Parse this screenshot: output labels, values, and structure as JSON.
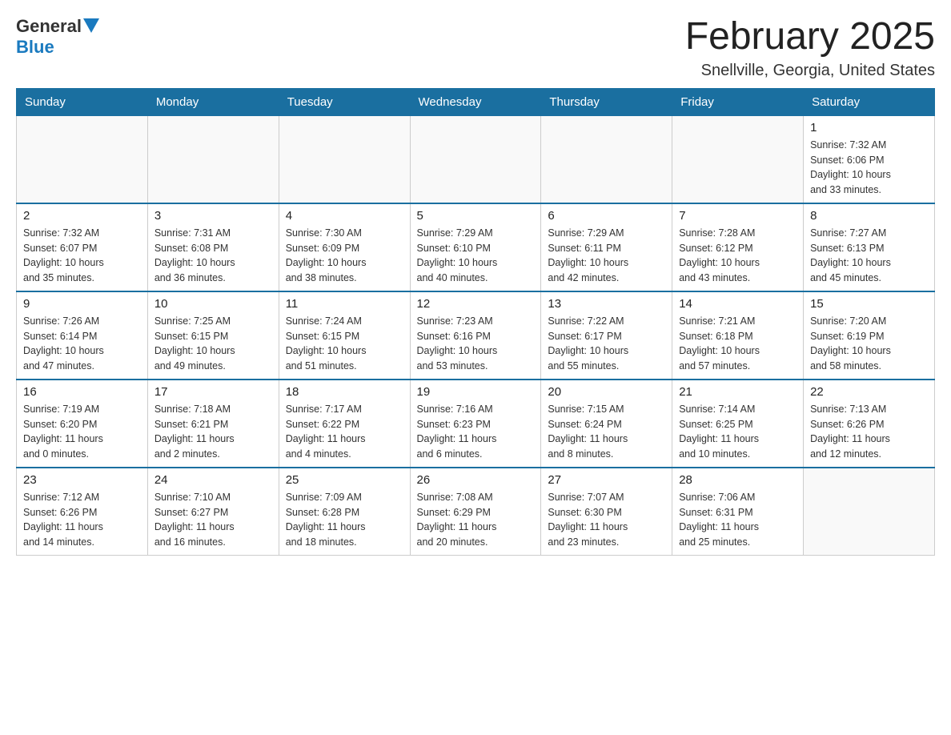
{
  "header": {
    "logo": {
      "general": "General",
      "blue": "Blue"
    },
    "title": "February 2025",
    "location": "Snellville, Georgia, United States"
  },
  "days_of_week": [
    "Sunday",
    "Monday",
    "Tuesday",
    "Wednesday",
    "Thursday",
    "Friday",
    "Saturday"
  ],
  "weeks": [
    [
      {
        "day": "",
        "info": ""
      },
      {
        "day": "",
        "info": ""
      },
      {
        "day": "",
        "info": ""
      },
      {
        "day": "",
        "info": ""
      },
      {
        "day": "",
        "info": ""
      },
      {
        "day": "",
        "info": ""
      },
      {
        "day": "1",
        "info": "Sunrise: 7:32 AM\nSunset: 6:06 PM\nDaylight: 10 hours\nand 33 minutes."
      }
    ],
    [
      {
        "day": "2",
        "info": "Sunrise: 7:32 AM\nSunset: 6:07 PM\nDaylight: 10 hours\nand 35 minutes."
      },
      {
        "day": "3",
        "info": "Sunrise: 7:31 AM\nSunset: 6:08 PM\nDaylight: 10 hours\nand 36 minutes."
      },
      {
        "day": "4",
        "info": "Sunrise: 7:30 AM\nSunset: 6:09 PM\nDaylight: 10 hours\nand 38 minutes."
      },
      {
        "day": "5",
        "info": "Sunrise: 7:29 AM\nSunset: 6:10 PM\nDaylight: 10 hours\nand 40 minutes."
      },
      {
        "day": "6",
        "info": "Sunrise: 7:29 AM\nSunset: 6:11 PM\nDaylight: 10 hours\nand 42 minutes."
      },
      {
        "day": "7",
        "info": "Sunrise: 7:28 AM\nSunset: 6:12 PM\nDaylight: 10 hours\nand 43 minutes."
      },
      {
        "day": "8",
        "info": "Sunrise: 7:27 AM\nSunset: 6:13 PM\nDaylight: 10 hours\nand 45 minutes."
      }
    ],
    [
      {
        "day": "9",
        "info": "Sunrise: 7:26 AM\nSunset: 6:14 PM\nDaylight: 10 hours\nand 47 minutes."
      },
      {
        "day": "10",
        "info": "Sunrise: 7:25 AM\nSunset: 6:15 PM\nDaylight: 10 hours\nand 49 minutes."
      },
      {
        "day": "11",
        "info": "Sunrise: 7:24 AM\nSunset: 6:15 PM\nDaylight: 10 hours\nand 51 minutes."
      },
      {
        "day": "12",
        "info": "Sunrise: 7:23 AM\nSunset: 6:16 PM\nDaylight: 10 hours\nand 53 minutes."
      },
      {
        "day": "13",
        "info": "Sunrise: 7:22 AM\nSunset: 6:17 PM\nDaylight: 10 hours\nand 55 minutes."
      },
      {
        "day": "14",
        "info": "Sunrise: 7:21 AM\nSunset: 6:18 PM\nDaylight: 10 hours\nand 57 minutes."
      },
      {
        "day": "15",
        "info": "Sunrise: 7:20 AM\nSunset: 6:19 PM\nDaylight: 10 hours\nand 58 minutes."
      }
    ],
    [
      {
        "day": "16",
        "info": "Sunrise: 7:19 AM\nSunset: 6:20 PM\nDaylight: 11 hours\nand 0 minutes."
      },
      {
        "day": "17",
        "info": "Sunrise: 7:18 AM\nSunset: 6:21 PM\nDaylight: 11 hours\nand 2 minutes."
      },
      {
        "day": "18",
        "info": "Sunrise: 7:17 AM\nSunset: 6:22 PM\nDaylight: 11 hours\nand 4 minutes."
      },
      {
        "day": "19",
        "info": "Sunrise: 7:16 AM\nSunset: 6:23 PM\nDaylight: 11 hours\nand 6 minutes."
      },
      {
        "day": "20",
        "info": "Sunrise: 7:15 AM\nSunset: 6:24 PM\nDaylight: 11 hours\nand 8 minutes."
      },
      {
        "day": "21",
        "info": "Sunrise: 7:14 AM\nSunset: 6:25 PM\nDaylight: 11 hours\nand 10 minutes."
      },
      {
        "day": "22",
        "info": "Sunrise: 7:13 AM\nSunset: 6:26 PM\nDaylight: 11 hours\nand 12 minutes."
      }
    ],
    [
      {
        "day": "23",
        "info": "Sunrise: 7:12 AM\nSunset: 6:26 PM\nDaylight: 11 hours\nand 14 minutes."
      },
      {
        "day": "24",
        "info": "Sunrise: 7:10 AM\nSunset: 6:27 PM\nDaylight: 11 hours\nand 16 minutes."
      },
      {
        "day": "25",
        "info": "Sunrise: 7:09 AM\nSunset: 6:28 PM\nDaylight: 11 hours\nand 18 minutes."
      },
      {
        "day": "26",
        "info": "Sunrise: 7:08 AM\nSunset: 6:29 PM\nDaylight: 11 hours\nand 20 minutes."
      },
      {
        "day": "27",
        "info": "Sunrise: 7:07 AM\nSunset: 6:30 PM\nDaylight: 11 hours\nand 23 minutes."
      },
      {
        "day": "28",
        "info": "Sunrise: 7:06 AM\nSunset: 6:31 PM\nDaylight: 11 hours\nand 25 minutes."
      },
      {
        "day": "",
        "info": ""
      }
    ]
  ]
}
